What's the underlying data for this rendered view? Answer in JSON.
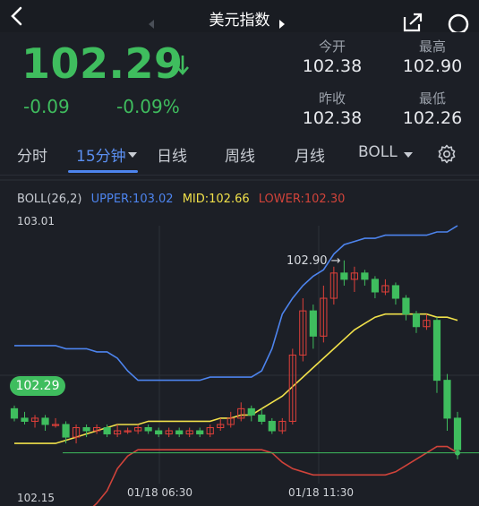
{
  "header": {
    "title": "美元指数"
  },
  "quote": {
    "price": "102.29",
    "change": "-0.09",
    "change_pct": "-0.09%",
    "open_label": "今开",
    "open": "102.38",
    "high_label": "最高",
    "high": "102.90",
    "prev_close_label": "昨收",
    "prev_close": "102.38",
    "low_label": "最低",
    "low": "102.26",
    "up_color": "#3fbd5e"
  },
  "tabs": [
    {
      "label": "分时"
    },
    {
      "label": "15分钟",
      "active": true
    },
    {
      "label": "日线"
    },
    {
      "label": "周线"
    },
    {
      "label": "月线"
    },
    {
      "label": "BOLL"
    }
  ],
  "indicator": {
    "name": "BOLL(26,2)",
    "upper": "UPPER:103.02",
    "mid": "MID:102.66",
    "lower": "LOWER:102.30",
    "upper_color": "#4d84ee",
    "mid_color": "#f0e04a",
    "lower_color": "#d0433a"
  },
  "chart_data": {
    "type": "candlestick",
    "y_axis_top": "103.01",
    "y_axis_bottom": "102.15",
    "ylim": [
      102.15,
      103.01
    ],
    "x_labels": [
      "01/18 06:30",
      "01/18 11:30"
    ],
    "high_marker": "102.90",
    "last_price": "102.29",
    "upper_band": [
      102.63,
      102.63,
      102.63,
      102.63,
      102.63,
      102.62,
      102.62,
      102.62,
      102.61,
      102.61,
      102.59,
      102.55,
      102.52,
      102.52,
      102.52,
      102.52,
      102.52,
      102.52,
      102.52,
      102.53,
      102.53,
      102.53,
      102.53,
      102.53,
      102.55,
      102.62,
      102.73,
      102.78,
      102.82,
      102.85,
      102.87,
      102.92,
      102.95,
      102.96,
      102.97,
      102.97,
      102.98,
      102.98,
      102.98,
      102.98,
      102.98,
      102.99,
      102.99,
      103.01
    ],
    "mid_band": [
      102.32,
      102.32,
      102.32,
      102.32,
      102.32,
      102.33,
      102.34,
      102.35,
      102.36,
      102.37,
      102.38,
      102.38,
      102.38,
      102.39,
      102.39,
      102.39,
      102.39,
      102.39,
      102.39,
      102.39,
      102.4,
      102.4,
      102.41,
      102.41,
      102.43,
      102.45,
      102.47,
      102.5,
      102.53,
      102.56,
      102.59,
      102.62,
      102.65,
      102.68,
      102.7,
      102.72,
      102.73,
      102.73,
      102.73,
      102.73,
      102.73,
      102.72,
      102.72,
      102.71
    ],
    "lower_band": [
      102.05,
      102.05,
      102.05,
      102.05,
      102.06,
      102.06,
      102.08,
      102.1,
      102.13,
      102.17,
      102.24,
      102.28,
      102.3,
      102.3,
      102.3,
      102.3,
      102.3,
      102.3,
      102.3,
      102.3,
      102.3,
      102.3,
      102.3,
      102.3,
      102.3,
      102.29,
      102.26,
      102.24,
      102.23,
      102.22,
      102.22,
      102.22,
      102.22,
      102.22,
      102.22,
      102.22,
      102.22,
      102.23,
      102.25,
      102.27,
      102.29,
      102.31,
      102.31,
      102.29
    ],
    "candles": [
      [
        102.43,
        102.4,
        102.44,
        102.39
      ],
      [
        102.4,
        102.39,
        102.42,
        102.38
      ],
      [
        102.39,
        102.4,
        102.41,
        102.37
      ],
      [
        102.4,
        102.38,
        102.41,
        102.36
      ],
      [
        102.38,
        102.38,
        102.4,
        102.37
      ],
      [
        102.38,
        102.34,
        102.39,
        102.32
      ],
      [
        102.34,
        102.37,
        102.38,
        102.32
      ],
      [
        102.37,
        102.36,
        102.38,
        102.34
      ],
      [
        102.36,
        102.37,
        102.38,
        102.35
      ],
      [
        102.37,
        102.35,
        102.38,
        102.34
      ],
      [
        102.35,
        102.36,
        102.38,
        102.34
      ],
      [
        102.36,
        102.36,
        102.37,
        102.35
      ],
      [
        102.36,
        102.37,
        102.38,
        102.35
      ],
      [
        102.37,
        102.36,
        102.38,
        102.35
      ],
      [
        102.36,
        102.35,
        102.37,
        102.34
      ],
      [
        102.35,
        102.36,
        102.37,
        102.34
      ],
      [
        102.36,
        102.35,
        102.37,
        102.34
      ],
      [
        102.35,
        102.36,
        102.37,
        102.34
      ],
      [
        102.36,
        102.35,
        102.37,
        102.34
      ],
      [
        102.35,
        102.37,
        102.38,
        102.34
      ],
      [
        102.37,
        102.38,
        102.4,
        102.36
      ],
      [
        102.38,
        102.4,
        102.42,
        102.37
      ],
      [
        102.4,
        102.43,
        102.45,
        102.39
      ],
      [
        102.43,
        102.41,
        102.44,
        102.39
      ],
      [
        102.41,
        102.39,
        102.43,
        102.38
      ],
      [
        102.39,
        102.36,
        102.4,
        102.35
      ],
      [
        102.36,
        102.39,
        102.4,
        102.35
      ],
      [
        102.39,
        102.6,
        102.62,
        102.38
      ],
      [
        102.6,
        102.74,
        102.78,
        102.58
      ],
      [
        102.74,
        102.66,
        102.76,
        102.62
      ],
      [
        102.66,
        102.78,
        102.82,
        102.64
      ],
      [
        102.78,
        102.86,
        102.88,
        102.76
      ],
      [
        102.86,
        102.84,
        102.9,
        102.82
      ],
      [
        102.84,
        102.86,
        102.88,
        102.8
      ],
      [
        102.86,
        102.84,
        102.87,
        102.82
      ],
      [
        102.84,
        102.8,
        102.85,
        102.78
      ],
      [
        102.8,
        102.82,
        102.84,
        102.79
      ],
      [
        102.82,
        102.78,
        102.83,
        102.76
      ],
      [
        102.78,
        102.73,
        102.79,
        102.71
      ],
      [
        102.73,
        102.69,
        102.74,
        102.67
      ],
      [
        102.69,
        102.71,
        102.73,
        102.68
      ],
      [
        102.71,
        102.52,
        102.72,
        102.48
      ],
      [
        102.52,
        102.4,
        102.54,
        102.36
      ],
      [
        102.4,
        102.3,
        102.42,
        102.27
      ]
    ]
  }
}
